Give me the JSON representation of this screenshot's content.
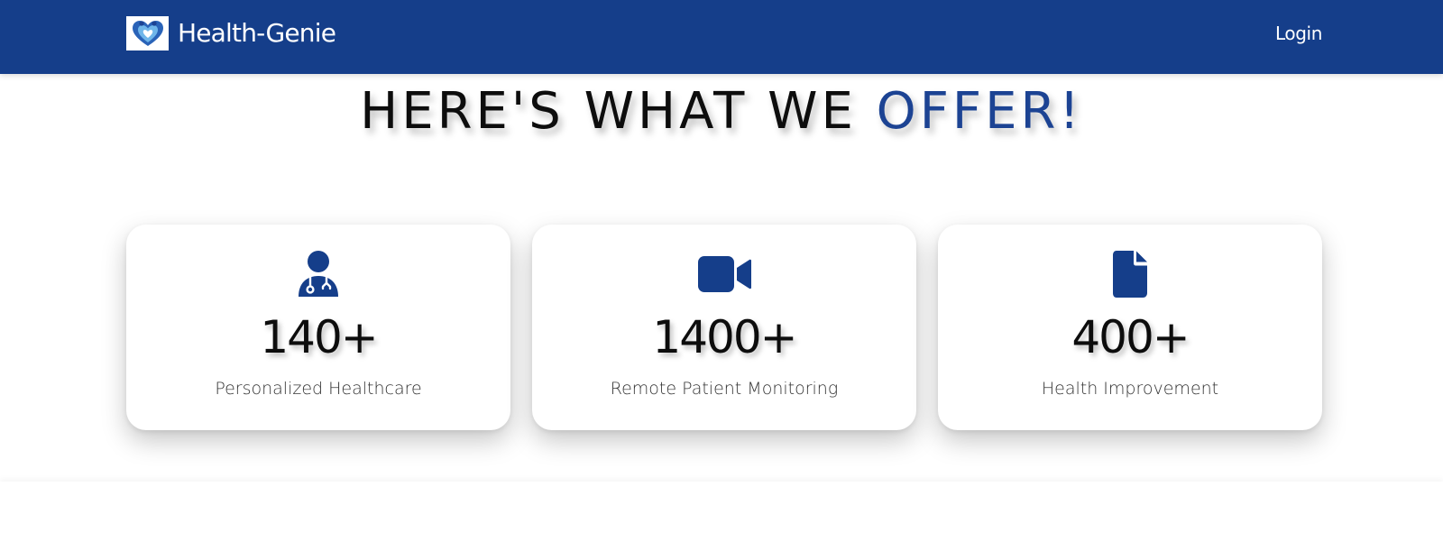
{
  "navbar": {
    "brand_name": "Health-Genie",
    "logo_icon": "heart-people-logo",
    "login_label": "Login",
    "background_color": "#153e8a"
  },
  "hero": {
    "headline_main": "HERE'S WHAT WE ",
    "headline_accent": "OFFER!",
    "accent_color": "#1c4393"
  },
  "cards": [
    {
      "icon": "doctor-icon",
      "number": "140+",
      "label": "Personalized Healthcare"
    },
    {
      "icon": "video-camera-icon",
      "number": "1400+",
      "label": "Remote Patient Monitoring"
    },
    {
      "icon": "document-icon",
      "number": "400+",
      "label": "Health Improvement"
    }
  ],
  "icon_color": "#153e8a"
}
